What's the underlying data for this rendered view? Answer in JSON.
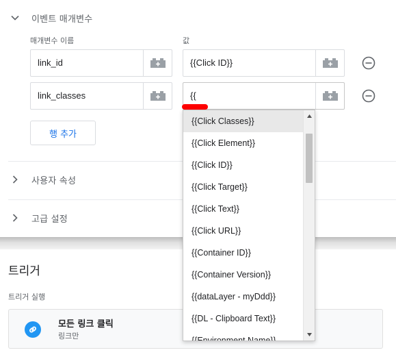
{
  "event_params": {
    "title": "이벤트 매개변수",
    "col_name_label": "매개변수 이름",
    "col_value_label": "값",
    "rows": [
      {
        "name": "link_id",
        "value": "{{Click ID}}"
      },
      {
        "name": "link_classes",
        "value": "{{"
      }
    ],
    "add_row_label": "행 추가"
  },
  "user_properties": {
    "title": "사용자 속성"
  },
  "advanced_settings": {
    "title": "고급 설정"
  },
  "dropdown": {
    "items": [
      "{{Click Classes}}",
      "{{Click Element}}",
      "{{Click ID}}",
      "{{Click Target}}",
      "{{Click Text}}",
      "{{Click URL}}",
      "{{Container ID}}",
      "{{Container Version}}",
      "{{dataLayer - myDdd}}",
      "{{DL - Clipboard Text}}",
      "{{Environment Name}}"
    ],
    "selected_index": 0
  },
  "trigger": {
    "title": "트리거",
    "subtitle": "트리거 실행",
    "name": "모든 링크 클릭",
    "type": "링크만"
  },
  "icons": {
    "brick": "variable-brick-icon",
    "remove": "minus-circle-icon",
    "expand": "chevron-icon",
    "link": "link-icon"
  },
  "colors": {
    "accent": "#1a73e8",
    "trigger_icon": "#2196f3",
    "annotation": "#ff0000"
  }
}
